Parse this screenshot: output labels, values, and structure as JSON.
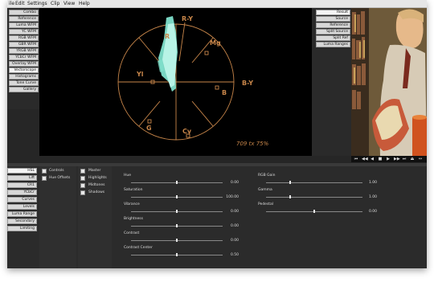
{
  "menubar": {
    "items": [
      "ile",
      "Edit",
      "Settings",
      "Clip",
      "View",
      "Help"
    ]
  },
  "scopes_list": [
    {
      "label": "Combo",
      "active": false
    },
    {
      "label": "Reference",
      "active": false
    },
    {
      "label": "Luma WFM",
      "active": false
    },
    {
      "label": "YC WFM",
      "active": false
    },
    {
      "label": "RGB WFM",
      "active": false
    },
    {
      "label": "GBR WFM",
      "active": false
    },
    {
      "label": "YRGB WFM",
      "active": false
    },
    {
      "label": "YCbCr WFM",
      "active": false
    },
    {
      "label": "Overlay WFM",
      "active": false
    },
    {
      "label": "Vectorscope",
      "active": true
    },
    {
      "label": "Histograms",
      "active": false
    },
    {
      "label": "Tone Curve",
      "active": false
    },
    {
      "label": "Gallery",
      "active": false
    }
  ],
  "vectorscope": {
    "targets": {
      "r_y": "R-Y",
      "r": "R",
      "mg": "Mg",
      "yl": "Yl",
      "b_y": "B-Y",
      "b": "B",
      "g": "G",
      "cy": "Cy"
    },
    "readout": "709 tx 75%",
    "trace_color": "#7fe0cc",
    "graticule_color": "#c8864a"
  },
  "view_list": [
    {
      "label": "Result",
      "active": true
    },
    {
      "label": "Source",
      "active": false
    },
    {
      "label": "Reference",
      "active": false
    },
    {
      "label": "Split Source",
      "active": false
    },
    {
      "label": "Split Ref",
      "active": false
    },
    {
      "label": "Luma Ranges",
      "active": false
    }
  ],
  "transport": {
    "buttons": [
      "⏮",
      "◀◀",
      "◀",
      "■",
      "▶",
      "▶▶",
      "⏭",
      "⏏",
      "↔"
    ]
  },
  "section_list": [
    {
      "label": "HSL",
      "active": true
    },
    {
      "label": "Lift",
      "active": false
    },
    {
      "label": "CR1",
      "active": false
    },
    {
      "label": "YCbCr",
      "active": false
    },
    {
      "label": "Curves",
      "active": false
    },
    {
      "label": "Levels",
      "active": false
    },
    {
      "label": "Luma Range",
      "active": false
    },
    {
      "label": "Secondary",
      "active": false
    },
    {
      "label": "Limiting",
      "active": false
    }
  ],
  "options": {
    "controls": "Controls",
    "hue_offsets": "Hue Offsets"
  },
  "ranges": {
    "master": "Master",
    "highlights": "Highlights",
    "midtones": "Midtones",
    "shadows": "Shadows"
  },
  "params_left": [
    {
      "label": "Hue",
      "value": "0.00",
      "fraction": 0.5
    },
    {
      "label": "Saturation",
      "value": "100.00",
      "fraction": 0.5
    },
    {
      "label": "Vibrance",
      "value": "0.00",
      "fraction": 0.5
    },
    {
      "label": "Brightness",
      "value": "0.00",
      "fraction": 0.5
    },
    {
      "label": "Contrast",
      "value": "0.00",
      "fraction": 0.5
    },
    {
      "label": "Contrast Center",
      "value": "0.50",
      "fraction": 0.5
    }
  ],
  "params_right": [
    {
      "label": "RGB Gain",
      "value": "1.00",
      "fraction": 0.25
    },
    {
      "label": "Gamma",
      "value": "1.00",
      "fraction": 0.25
    },
    {
      "label": "Pedestal",
      "value": "0.00",
      "fraction": 0.5
    }
  ]
}
